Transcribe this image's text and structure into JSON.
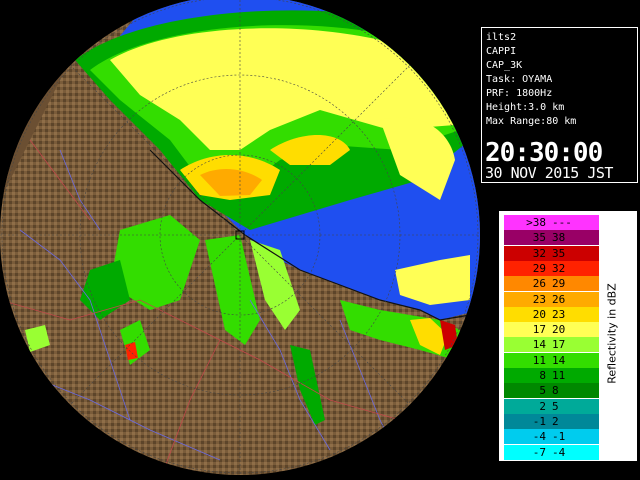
{
  "info": {
    "site": "ilts2",
    "product": "CAPPI",
    "product_code": "CAP_3K",
    "task": "Task: OYAMA",
    "prf": "PRF: 1800Hz",
    "height": "Height:3.0 km",
    "max_range": "Max Range:80 km",
    "time": "20:30:00",
    "date": "30 NOV 2015 JST"
  },
  "legend": {
    "unit_label": "Reflectivity in dBZ",
    "rows": [
      {
        "lo": ">38",
        "hi": "---",
        "color": "#ff33ff"
      },
      {
        "lo": "35",
        "hi": "38",
        "color": "#990066"
      },
      {
        "lo": "32",
        "hi": "35",
        "color": "#cc0000"
      },
      {
        "lo": "29",
        "hi": "32",
        "color": "#ff2200"
      },
      {
        "lo": "26",
        "hi": "29",
        "color": "#ff8800"
      },
      {
        "lo": "23",
        "hi": "26",
        "color": "#ffaa00"
      },
      {
        "lo": "20",
        "hi": "23",
        "color": "#ffdd00"
      },
      {
        "lo": "17",
        "hi": "20",
        "color": "#ffff55"
      },
      {
        "lo": "14",
        "hi": "17",
        "color": "#99ff33"
      },
      {
        "lo": "11",
        "hi": "14",
        "color": "#33dd00"
      },
      {
        "lo": "8",
        "hi": "11",
        "color": "#00aa00"
      },
      {
        "lo": "5",
        "hi": "8",
        "color": "#008800"
      },
      {
        "lo": "2",
        "hi": "5",
        "color": "#00aa99"
      },
      {
        "lo": "-1",
        "hi": "2",
        "color": "#008899"
      },
      {
        "lo": "-4",
        "hi": "-1",
        "color": "#00ccee"
      },
      {
        "lo": "-7",
        "hi": "-4",
        "color": "#00ffff"
      }
    ]
  },
  "colors": {
    "sea": "#1f4ff0",
    "land": "#7a5c3a",
    "range_ring": "#555555"
  }
}
